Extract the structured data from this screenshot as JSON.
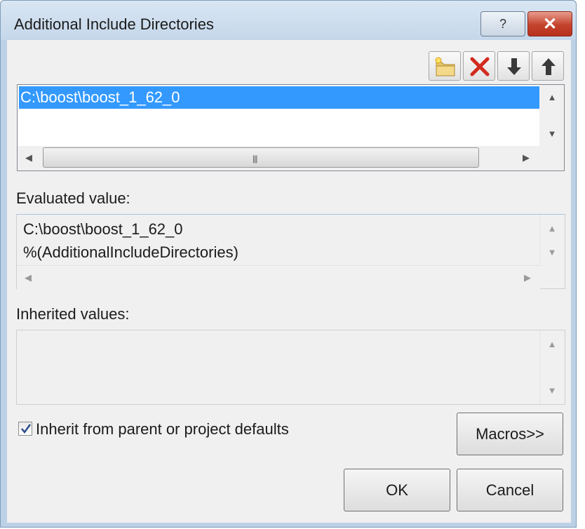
{
  "window": {
    "title": "Additional Include Directories",
    "help_label": "?",
    "close_label": "✕"
  },
  "toolbar": {
    "icons": [
      "new-folder-icon",
      "delete-icon",
      "move-down-icon",
      "move-up-icon"
    ]
  },
  "directories_list": {
    "items": [
      "C:\\boost\\boost_1_62_0"
    ],
    "selected_index": 0
  },
  "evaluated": {
    "label": "Evaluated value:",
    "lines": [
      "C:\\boost\\boost_1_62_0",
      "%(AdditionalIncludeDirectories)"
    ]
  },
  "inherited": {
    "label": "Inherited values:",
    "lines": []
  },
  "inherit_checkbox": {
    "label": "Inherit from parent or project defaults",
    "checked": true
  },
  "buttons": {
    "macros": "Macros>>",
    "ok": "OK",
    "cancel": "Cancel"
  },
  "colors": {
    "selection": "#3399ff",
    "close": "#c4432d"
  }
}
